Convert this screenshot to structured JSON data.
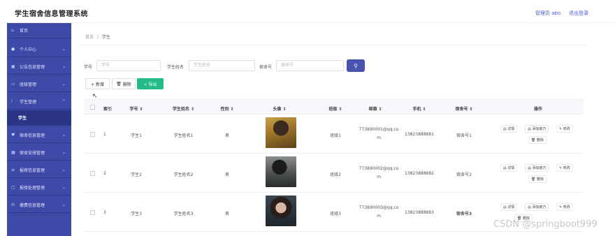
{
  "header": {
    "title": "学生宿舍信息管理系统",
    "admin": "管理员 abo",
    "logout": "退出登录"
  },
  "sidebar": {
    "items": [
      {
        "label": "首页",
        "icon": "home-icon"
      },
      {
        "label": "个人中心",
        "icon": "user-icon"
      },
      {
        "label": "公告信息管理",
        "icon": "notice-icon"
      },
      {
        "label": "班级管理",
        "icon": "class-icon"
      },
      {
        "label": "学生管理",
        "icon": "student-icon"
      },
      {
        "label": "学生",
        "icon": ""
      },
      {
        "label": "宿舍信息管理",
        "icon": "dorm-icon"
      },
      {
        "label": "宿舍安排管理",
        "icon": "arrange-icon"
      },
      {
        "label": "报修信息管理",
        "icon": "repair-icon"
      },
      {
        "label": "报修处理管理",
        "icon": "process-icon"
      },
      {
        "label": "缴费信息管理",
        "icon": "fee-icon"
      }
    ]
  },
  "breadcrumb": {
    "home": "首页",
    "sep": "/",
    "current": "学生"
  },
  "search": {
    "no_label": "学号",
    "no_placeholder": "学号",
    "name_label": "学生姓名",
    "name_placeholder": "学生姓名",
    "dorm_label": "宿舍号",
    "dorm_placeholder": "宿舍号"
  },
  "toolbar": {
    "add": "+ 新增",
    "delete": "删除",
    "export": "+ 导出"
  },
  "table": {
    "headers": [
      "索引",
      "学号 ⇕",
      "学生姓名 ⇕",
      "性别 ⇕",
      "头像 ⇕",
      "班级 ⇕",
      "邮箱 ⇕",
      "手机 ⇕",
      "宿舍号 ⇕",
      "操作"
    ],
    "rows": [
      {
        "index": "1",
        "no": "学生1",
        "name": "学生姓名1",
        "gender": "男",
        "class": "班级1",
        "email": "773890001@qq.com",
        "phone": "13823888881",
        "dorm": "宿舍号1"
      },
      {
        "index": "2",
        "no": "学生2",
        "name": "学生姓名2",
        "gender": "男",
        "class": "班级2",
        "email": "773890002@qq.com",
        "phone": "13823888882",
        "dorm": "宿舍号2"
      },
      {
        "index": "3",
        "no": "学生3",
        "name": "学生姓名3",
        "gender": "男",
        "class": "班级3",
        "email": "773890003@qq.com",
        "phone": "13823888883",
        "dorm": "宿舍号3"
      }
    ],
    "actions": {
      "detail": "详情",
      "add_score": "添加南方",
      "edit": "修改",
      "delete": "删除"
    }
  },
  "watermark": "CSDN @springboot999",
  "colors": {
    "sidebar": "#3f4aa8",
    "accent": "#4a53b0",
    "green": "#26b98a"
  }
}
